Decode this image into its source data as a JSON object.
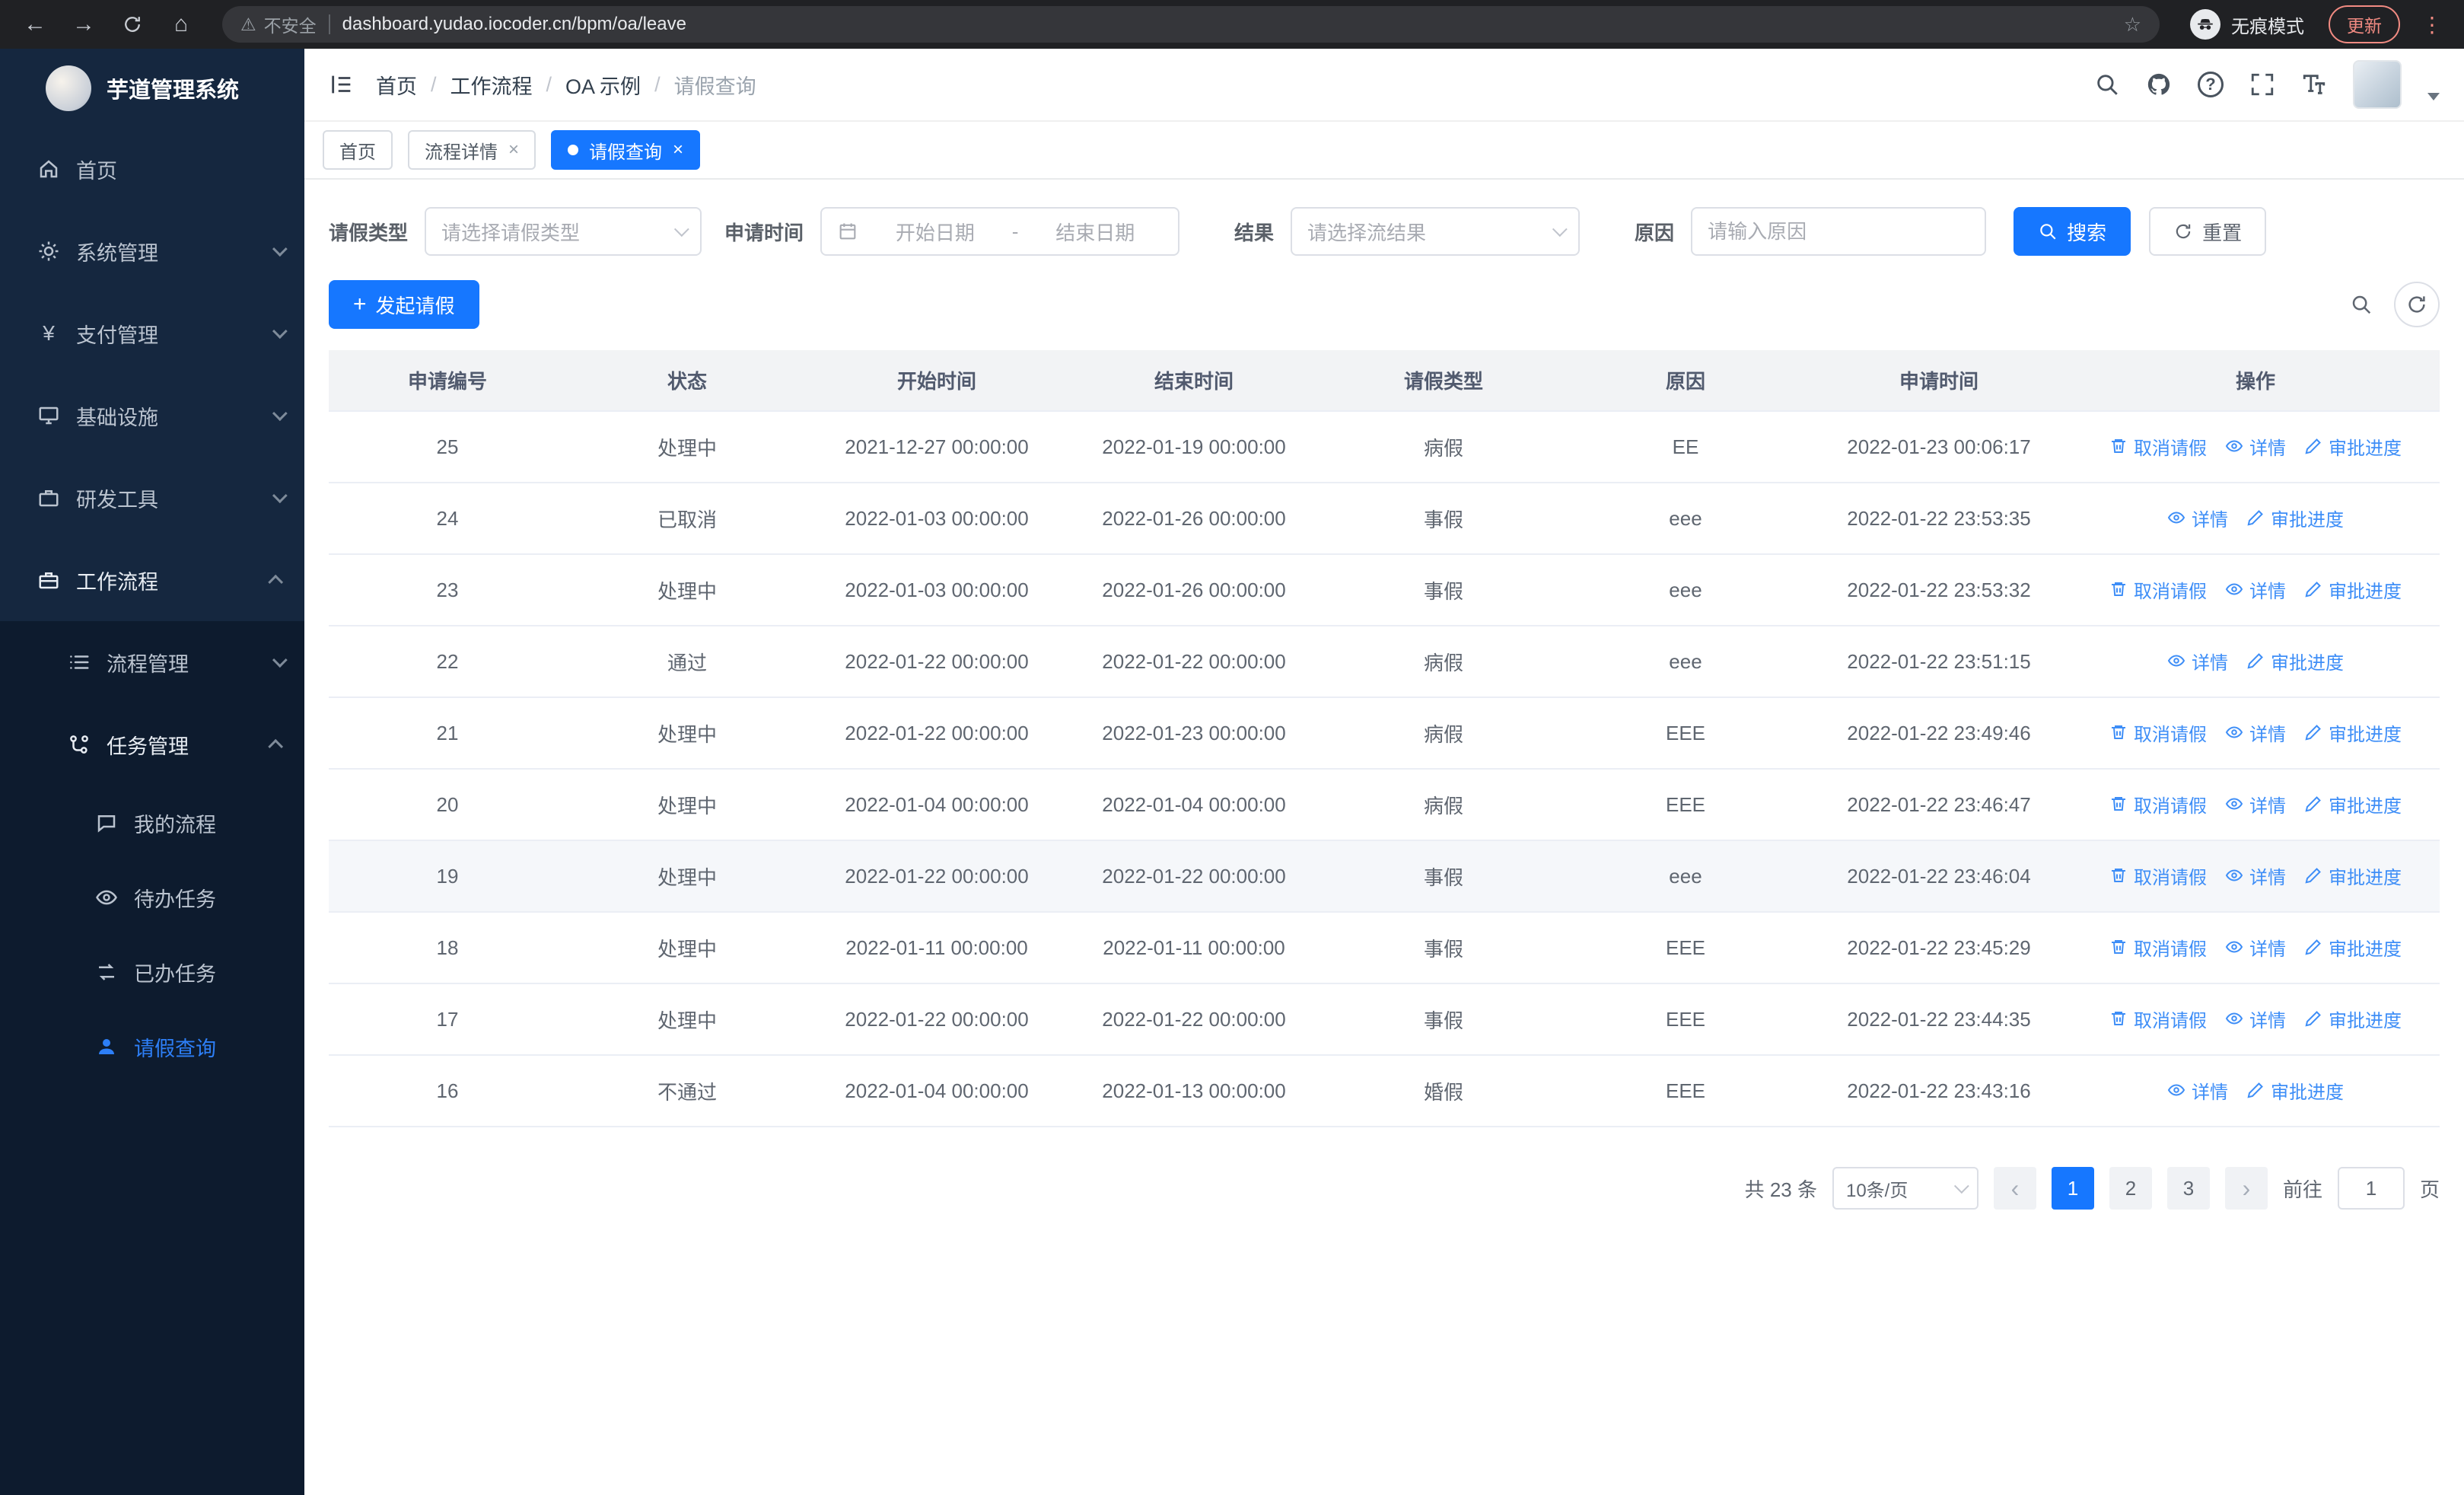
{
  "browser": {
    "security_chip": "不安全",
    "url": "dashboard.yudao.iocoder.cn/bpm/oa/leave",
    "incognito_label": "无痕模式",
    "update_label": "更新"
  },
  "icons": {
    "back": "←",
    "forward": "→",
    "home": "⌂",
    "warning": "⚠",
    "star": "☆",
    "menu_dots": "⋮",
    "close": "×",
    "question": "?",
    "plus": "+",
    "yen": "¥",
    "prev": "‹",
    "next": "›"
  },
  "colors": {
    "primary": "#1677ff",
    "link": "#3e8ef7",
    "sidebar_bg": "#15273f",
    "submenu_bg": "#0d1b2e"
  },
  "sidebar": {
    "logo_title": "芋道管理系统",
    "items": [
      {
        "label": "首页"
      },
      {
        "label": "系统管理"
      },
      {
        "label": "支付管理"
      },
      {
        "label": "基础设施"
      },
      {
        "label": "研发工具"
      },
      {
        "label": "工作流程"
      }
    ],
    "workflow_children": [
      {
        "label": "流程管理"
      },
      {
        "label": "任务管理"
      }
    ],
    "task_children": [
      {
        "label": "我的流程"
      },
      {
        "label": "待办任务"
      },
      {
        "label": "已办任务"
      },
      {
        "label": "请假查询"
      }
    ]
  },
  "header": {
    "breadcrumb": [
      "首页",
      "工作流程",
      "OA 示例",
      "请假查询"
    ],
    "separator": "/"
  },
  "tabs": [
    {
      "label": "首页"
    },
    {
      "label": "流程详情"
    },
    {
      "label": "请假查询"
    }
  ],
  "filters": {
    "leave_type_label": "请假类型",
    "leave_type_placeholder": "请选择请假类型",
    "apply_time_label": "申请时间",
    "start_date_placeholder": "开始日期",
    "range_separator": "-",
    "end_date_placeholder": "结束日期",
    "result_label": "结果",
    "result_placeholder": "请选择流结果",
    "reason_label": "原因",
    "reason_placeholder": "请输入原因",
    "search_button": "搜索",
    "reset_button": "重置"
  },
  "toolbar": {
    "create_label": "发起请假"
  },
  "table": {
    "columns": [
      "申请编号",
      "状态",
      "开始时间",
      "结束时间",
      "请假类型",
      "原因",
      "申请时间",
      "操作"
    ],
    "action_labels": {
      "cancel": "取消请假",
      "detail": "详情",
      "progress": "审批进度"
    },
    "rows": [
      {
        "id": "25",
        "status": "处理中",
        "start": "2021-12-27 00:00:00",
        "end": "2022-01-19 00:00:00",
        "type": "病假",
        "reason": "EE",
        "applied": "2022-01-23 00:06:17",
        "actions": [
          "cancel",
          "detail",
          "progress"
        ]
      },
      {
        "id": "24",
        "status": "已取消",
        "start": "2022-01-03 00:00:00",
        "end": "2022-01-26 00:00:00",
        "type": "事假",
        "reason": "eee",
        "applied": "2022-01-22 23:53:35",
        "actions": [
          "detail",
          "progress"
        ]
      },
      {
        "id": "23",
        "status": "处理中",
        "start": "2022-01-03 00:00:00",
        "end": "2022-01-26 00:00:00",
        "type": "事假",
        "reason": "eee",
        "applied": "2022-01-22 23:53:32",
        "actions": [
          "cancel",
          "detail",
          "progress"
        ]
      },
      {
        "id": "22",
        "status": "通过",
        "start": "2022-01-22 00:00:00",
        "end": "2022-01-22 00:00:00",
        "type": "病假",
        "reason": "eee",
        "applied": "2022-01-22 23:51:15",
        "actions": [
          "detail",
          "progress"
        ]
      },
      {
        "id": "21",
        "status": "处理中",
        "start": "2022-01-22 00:00:00",
        "end": "2022-01-23 00:00:00",
        "type": "病假",
        "reason": "EEE",
        "applied": "2022-01-22 23:49:46",
        "actions": [
          "cancel",
          "detail",
          "progress"
        ]
      },
      {
        "id": "20",
        "status": "处理中",
        "start": "2022-01-04 00:00:00",
        "end": "2022-01-04 00:00:00",
        "type": "病假",
        "reason": "EEE",
        "applied": "2022-01-22 23:46:47",
        "actions": [
          "cancel",
          "detail",
          "progress"
        ]
      },
      {
        "id": "19",
        "status": "处理中",
        "start": "2022-01-22 00:00:00",
        "end": "2022-01-22 00:00:00",
        "type": "事假",
        "reason": "eee",
        "applied": "2022-01-22 23:46:04",
        "actions": [
          "cancel",
          "detail",
          "progress"
        ],
        "highlighted": true
      },
      {
        "id": "18",
        "status": "处理中",
        "start": "2022-01-11 00:00:00",
        "end": "2022-01-11 00:00:00",
        "type": "事假",
        "reason": "EEE",
        "applied": "2022-01-22 23:45:29",
        "actions": [
          "cancel",
          "detail",
          "progress"
        ]
      },
      {
        "id": "17",
        "status": "处理中",
        "start": "2022-01-22 00:00:00",
        "end": "2022-01-22 00:00:00",
        "type": "事假",
        "reason": "EEE",
        "applied": "2022-01-22 23:44:35",
        "actions": [
          "cancel",
          "detail",
          "progress"
        ]
      },
      {
        "id": "16",
        "status": "不通过",
        "start": "2022-01-04 00:00:00",
        "end": "2022-01-13 00:00:00",
        "type": "婚假",
        "reason": "EEE",
        "applied": "2022-01-22 23:43:16",
        "actions": [
          "detail",
          "progress"
        ]
      }
    ]
  },
  "pagination": {
    "total": "共 23 条",
    "page_size": "10条/页",
    "pages": [
      "1",
      "2",
      "3"
    ],
    "active_page": "1",
    "goto_label": "前往",
    "goto_value": "1",
    "goto_unit": "页"
  }
}
